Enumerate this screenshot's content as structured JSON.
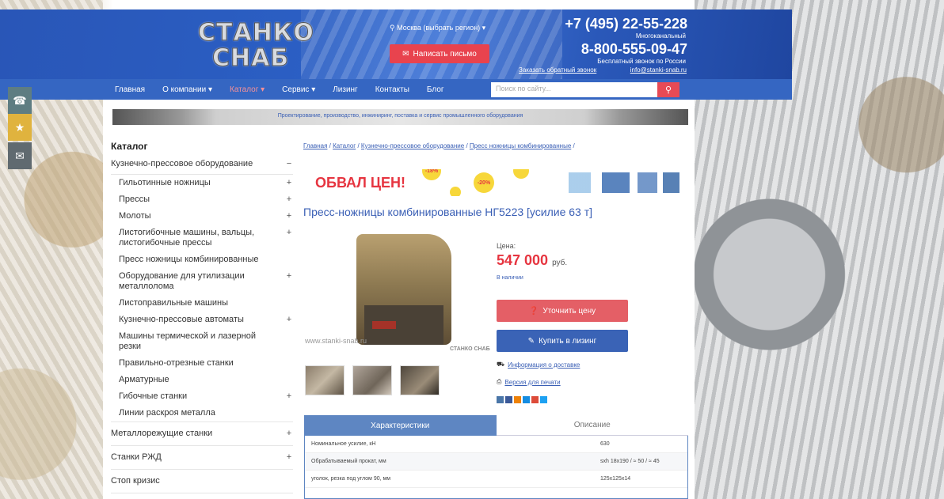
{
  "header": {
    "logo_line1": "СТАНКО",
    "logo_line2": "СНАБ",
    "region": "Москва (выбрать регион) ▾",
    "write_label": "Написать письмо",
    "phone1": "+7 (495) 22-55-228",
    "phone1_note": "Многоканальный",
    "phone2": "8-800-555-09-47",
    "phone2_note": "Бесплатный звонок по России",
    "callback": "Заказать обратный звонок",
    "email": "info@stanki-snab.ru"
  },
  "nav": {
    "items": [
      "Главная",
      "О компании ▾",
      "Каталог ▾",
      "Сервис ▾",
      "Лизинг",
      "Контакты",
      "Блог"
    ],
    "search_placeholder": "Поиск по сайту..."
  },
  "banner_text": "Проектирование, производство, инжиниринг, поставка и сервис промышленного оборудования",
  "catalog": {
    "title": "Каталог",
    "top": {
      "label": "Кузнечно-прессовое оборудование",
      "sign": "−"
    },
    "subs": [
      {
        "label": "Гильотинные ножницы",
        "sign": "+"
      },
      {
        "label": "Прессы",
        "sign": "+"
      },
      {
        "label": "Молоты",
        "sign": "+"
      },
      {
        "label": "Листогибочные машины, вальцы, листогибочные прессы",
        "sign": "+"
      },
      {
        "label": "Пресс ножницы комбинированные",
        "sign": ""
      },
      {
        "label": "Оборудование для утилизации металлолома",
        "sign": "+"
      },
      {
        "label": "Листоправильные машины",
        "sign": ""
      },
      {
        "label": "Кузнечно-прессовые автоматы",
        "sign": "+"
      },
      {
        "label": "Машины термической и лазерной резки",
        "sign": ""
      },
      {
        "label": "Правильно-отрезные станки",
        "sign": ""
      },
      {
        "label": "Арматурные",
        "sign": ""
      },
      {
        "label": "Гибочные станки",
        "sign": "+"
      },
      {
        "label": "Линии раскроя металла",
        "sign": ""
      }
    ],
    "others": [
      {
        "label": "Металлорежущие станки",
        "sign": "+"
      },
      {
        "label": "Станки РЖД",
        "sign": "+"
      },
      {
        "label": "Стоп кризис",
        "sign": ""
      }
    ]
  },
  "breadcrumbs": [
    "Главная",
    "Каталог",
    "Кузнечно-прессовое оборудование",
    "Пресс ножницы комбинированные"
  ],
  "promo": {
    "text": "ОБВАЛ ЦЕН!",
    "badge1": "-18%",
    "badge2": "-20%"
  },
  "product": {
    "title": "Пресс-ножницы комбинированные НГ5223 [усилие 63 т]",
    "price_label": "Цена:",
    "price": "547 000",
    "currency": "руб.",
    "stock": "В наличии",
    "btn_price": "Уточнить цену",
    "btn_lease": "Купить в лизинг",
    "delivery": "Информация о доставке",
    "print": "Версия для печати",
    "watermark": "www.stanki-snab.ru",
    "mini_logo": "СТАНКО СНАБ"
  },
  "tabs": [
    "Характеристики",
    "Описание"
  ],
  "specs": [
    {
      "k": "Номинальное усилие, кН",
      "v": "630"
    },
    {
      "k": "Обрабатываемый прокат, мм",
      "v": "sxh 18x190 / ≈ 50 / ≈ 45"
    },
    {
      "k": "уголок, резка под углом 90, мм",
      "v": "125x125x14"
    }
  ],
  "colors": {
    "primary": "#3566c2",
    "accent": "#e63540",
    "lease": "#3a63b6"
  }
}
